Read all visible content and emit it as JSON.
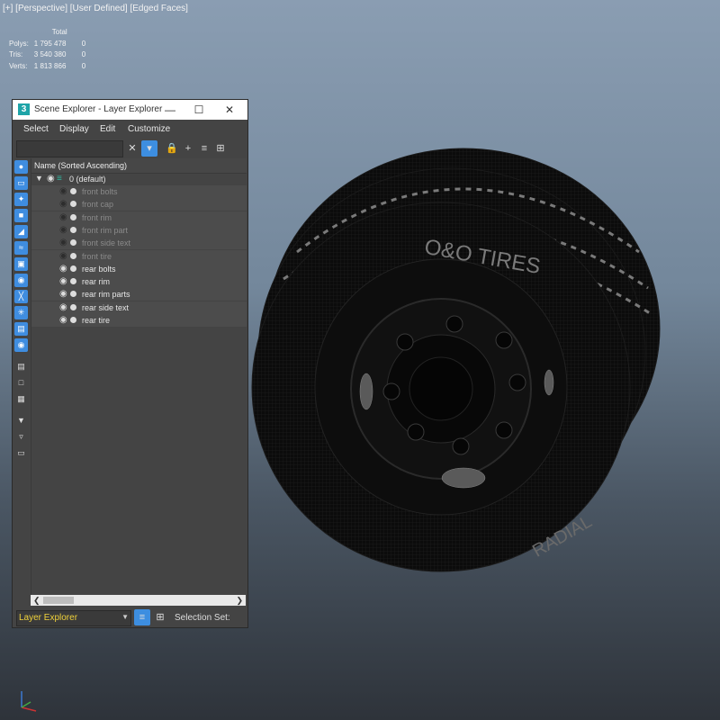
{
  "viewport": {
    "label": "[+] [Perspective] [User Defined] [Edged Faces]",
    "stats": {
      "header": "Total",
      "rows": [
        {
          "label": "Polys:",
          "total": "1 795 478",
          "selected": "0"
        },
        {
          "label": "Tris:",
          "total": "3 540 380",
          "selected": "0"
        },
        {
          "label": "Verts:",
          "total": "1 813 866",
          "selected": "0"
        }
      ]
    },
    "tire_text": {
      "brand": "O&O TIRES",
      "radial": "RADIAL"
    }
  },
  "explorer": {
    "title": "Scene Explorer - Layer Explorer",
    "logo": "3",
    "window_controls": {
      "minimize": "—",
      "maximize": "☐",
      "close": "✕"
    },
    "menu": [
      "Select",
      "Display",
      "Edit",
      "Customize"
    ],
    "search": {
      "value": "",
      "clear": "✕"
    },
    "column_header": "Name (Sorted Ascending)",
    "layer": {
      "name": "0 (default)",
      "expanded": true
    },
    "objects": [
      {
        "name": "front bolts",
        "visible": false
      },
      {
        "name": "front cap",
        "visible": false
      },
      {
        "name": "front rim",
        "visible": false
      },
      {
        "name": "front rim part",
        "visible": false
      },
      {
        "name": "front side text",
        "visible": false
      },
      {
        "name": "front tire",
        "visible": false
      },
      {
        "name": "rear bolts",
        "visible": true
      },
      {
        "name": "rear rim",
        "visible": true
      },
      {
        "name": "rear rim parts",
        "visible": true
      },
      {
        "name": "rear side text",
        "visible": true
      },
      {
        "name": "rear tire",
        "visible": true
      }
    ],
    "bottom": {
      "explorer_mode": "Layer Explorer",
      "selection_set_label": "Selection Set:"
    }
  },
  "colors": {
    "accent": "#3d8ee0",
    "dropdown_text": "#f0d23a",
    "panel_bg": "#444444"
  }
}
